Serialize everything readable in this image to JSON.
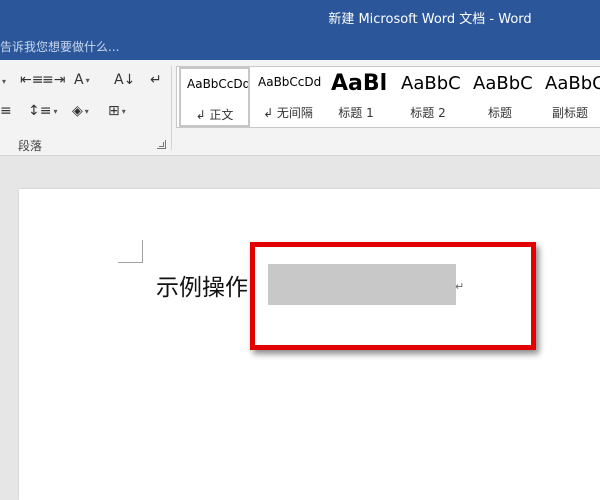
{
  "window": {
    "title": "新建 Microsoft Word 文档 - Word"
  },
  "tell_me": {
    "placeholder": "告诉我您想要做什么..."
  },
  "ribbon": {
    "paragraph_group": {
      "label": "段落",
      "buttons": [
        {
          "name": "indent-icon"
        },
        {
          "name": "chinese-layout-icon"
        },
        {
          "name": "sort-icon"
        },
        {
          "name": "show-marks-icon"
        },
        {
          "name": "align-icon"
        },
        {
          "name": "line-spacing-icon"
        },
        {
          "name": "shading-icon"
        },
        {
          "name": "borders-icon"
        }
      ],
      "glyphs": {
        "decrease_indent": "⇤≡",
        "increase_indent": "≡⇥",
        "chinese_layout": "A",
        "sort": "A↓",
        "show_marks": "↵",
        "align": "≡",
        "line_spacing": "↕≡",
        "shading": "◈",
        "borders": "⊞"
      }
    },
    "styles": [
      {
        "preview": "AaBbCcDd",
        "name": "↲ 正文",
        "selected": true
      },
      {
        "preview": "AaBbCcDd",
        "name": "↲ 无间隔",
        "selected": false
      },
      {
        "preview": "AaBl",
        "name": "标题 1",
        "selected": false
      },
      {
        "preview": "AaBbC",
        "name": "标题 2",
        "selected": false
      },
      {
        "preview": "AaBbC",
        "name": "标题",
        "selected": false
      },
      {
        "preview": "AaBbC",
        "name": "副标题",
        "selected": false
      }
    ]
  },
  "document": {
    "text": "示例操作",
    "paragraph_mark": "↵"
  },
  "colors": {
    "title_bar": "#2b579a",
    "highlight_box": "#e30000",
    "selection": "#c8c8c8"
  }
}
